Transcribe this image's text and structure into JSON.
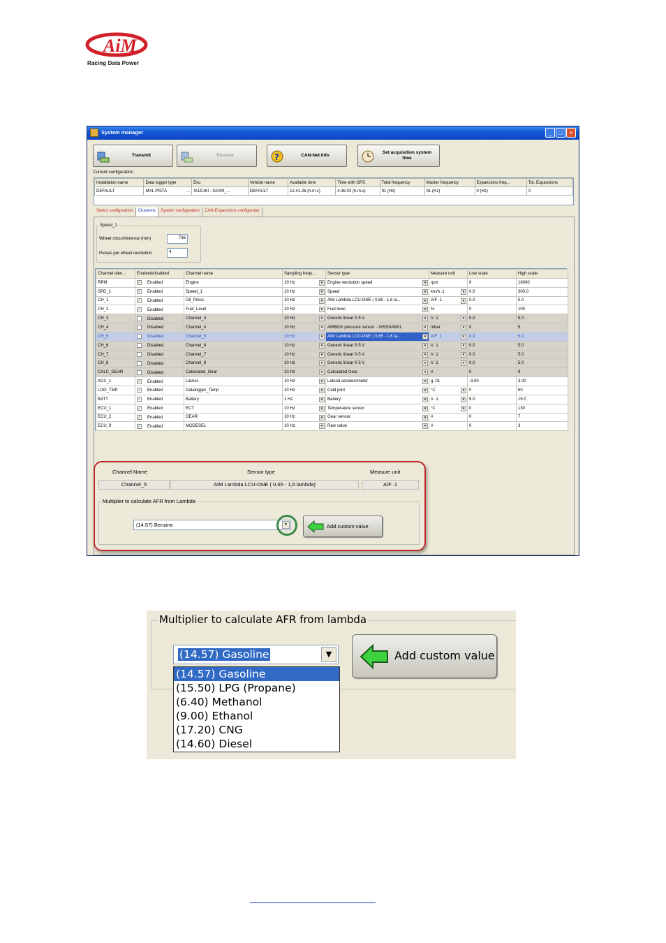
{
  "logo": {
    "brand": "AiM",
    "tagline": "Racing Data Power"
  },
  "window": {
    "title": "System manager",
    "toolbar": {
      "transmit": "Transmit",
      "receive": "Receive",
      "can_net_info": "CAN-Net info",
      "set_acq_line1": "Set acquisition system",
      "set_acq_line2": "time"
    },
    "current_config_label": "Current configuration",
    "config_table": {
      "headers": [
        "Installation name",
        "Data logger type",
        "Ecu",
        "Vehicle name",
        "Available time",
        "Time with GPS",
        "Total frequency",
        "Master frequency",
        "Expansions freq...",
        "Tot. Expansions"
      ],
      "row": [
        "DEFAULT",
        "MXL PISTA",
        "SUZUKI - GSXR_...",
        "DEFAULT",
        "12.41.26 (h.m.s)",
        "4.36.03 (h.m.s)",
        "91 (Hz)",
        "91 (Hz)",
        "0 (Hz)",
        "0"
      ],
      "row_browse": "..."
    },
    "tabs": [
      "Select configuration",
      "Channels",
      "System configuration",
      "CAN-Expansions configurator"
    ],
    "speed_group": {
      "title": "Speed_1",
      "wheel_label": "Wheel circumference   (mm)",
      "wheel_value": "736",
      "pulses_label": "Pulses per wheel revolution",
      "pulses_value": "4"
    },
    "channels": {
      "headers": [
        "Channel iden...",
        "Enabled/disabled",
        "Channel name",
        "Sampling frequ...",
        "Sensor type",
        "Measure unit",
        "Low scale",
        "High scale"
      ],
      "check_mark": "✓",
      "rows": [
        {
          "id": "RPM",
          "checked": true,
          "status": "Enabled",
          "name": "Engine",
          "freq": "10 Hz",
          "sensor": "Engine revolution speed",
          "unit": "rpm",
          "low": "0",
          "high": "16000",
          "state": "normal"
        },
        {
          "id": "SPD_1",
          "checked": true,
          "status": "Enabled",
          "name": "Speed_1",
          "freq": "10 Hz",
          "sensor": "Speed",
          "unit": "km/h  .1",
          "low": "0.0",
          "high": "300.0",
          "state": "normal"
        },
        {
          "id": "CH_1",
          "checked": true,
          "status": "Enabled",
          "name": "Oil_Press",
          "freq": "10 Hz",
          "sensor": "AIM Lambda LCU-ONE ( 0,65 - 1,6 la...",
          "unit": "A/F  .1",
          "low": "0.0",
          "high": "5.0",
          "state": "normal"
        },
        {
          "id": "CH_2",
          "checked": true,
          "status": "Enabled",
          "name": "Fuel_Level",
          "freq": "10 Hz",
          "sensor": "Fuel level",
          "unit": "%",
          "low": "0",
          "high": "100",
          "state": "normal"
        },
        {
          "id": "CH_3",
          "checked": false,
          "status": "Disabled",
          "name": "Channel_3",
          "freq": "10 Hz",
          "sensor": "Generic linear 0-5 V",
          "unit": "V  .1",
          "low": "0.0",
          "high": "5.0",
          "state": "disabled"
        },
        {
          "id": "CH_4",
          "checked": false,
          "status": "Disabled",
          "name": "Channel_4",
          "freq": "10 Hz",
          "sensor": "AIRBOX pressure sensor - X05SNAB01",
          "unit": "mbar",
          "low": "0",
          "high": "5",
          "state": "disabled"
        },
        {
          "id": "CH_5",
          "checked": false,
          "status": "Disabled",
          "name": "Channel_5",
          "freq": "10 Hz",
          "sensor": "AIM Lambda LCU-ONE ( 0,65 - 1,6 la...",
          "unit": "A/F  .1",
          "low": "0.0",
          "high": "5.0",
          "state": "selected"
        },
        {
          "id": "CH_6",
          "checked": false,
          "status": "Disabled",
          "name": "Channel_6",
          "freq": "10 Hz",
          "sensor": "Generic linear 0-5 V",
          "unit": "V  .1",
          "low": "0.0",
          "high": "5.0",
          "state": "disabled"
        },
        {
          "id": "CH_7",
          "checked": false,
          "status": "Disabled",
          "name": "Channel_7",
          "freq": "10 Hz",
          "sensor": "Generic linear 0-5 V",
          "unit": "V  .1",
          "low": "0.0",
          "high": "5.0",
          "state": "disabled"
        },
        {
          "id": "CH_8",
          "checked": false,
          "status": "Disabled",
          "name": "Channel_8",
          "freq": "10 Hz",
          "sensor": "Generic linear 0-5 V",
          "unit": "V  .1",
          "low": "0.0",
          "high": "5.0",
          "state": "disabled"
        },
        {
          "id": "CALC_GEAR",
          "checked": false,
          "status": "Disabled",
          "name": "Calculated_Gear",
          "freq": "10 Hz",
          "sensor": "Calculated Gear",
          "unit": "#",
          "low": "0",
          "high": "9",
          "state": "disabled"
        },
        {
          "id": "ACC_1",
          "checked": true,
          "status": "Enabled",
          "name": "LatAcc",
          "freq": "10 Hz",
          "sensor": "Lateral accelerometer",
          "unit": "g  .01",
          "low": "-3.00",
          "high": "3.00",
          "state": "normal"
        },
        {
          "id": "LOG_TMP",
          "checked": true,
          "status": "Enabled",
          "name": "Datalogger_Temp",
          "freq": "10 Hz",
          "sensor": "Cold joint",
          "unit": "°C",
          "low": "0",
          "high": "50",
          "state": "normal"
        },
        {
          "id": "BATT",
          "checked": true,
          "status": "Enabled",
          "name": "Battery",
          "freq": "1 Hz",
          "sensor": "Battery",
          "unit": "V  .1",
          "low": "5.0",
          "high": "15.0",
          "state": "normal"
        },
        {
          "id": "ECU_1",
          "checked": true,
          "status": "Enabled",
          "name": "ECT",
          "freq": "10 Hz",
          "sensor": "Temperature sensor",
          "unit": "°C",
          "low": "0",
          "high": "130",
          "state": "normal"
        },
        {
          "id": "ECU_2",
          "checked": true,
          "status": "Enabled",
          "name": "GEAR",
          "freq": "10 Hz",
          "sensor": "Gear sensor",
          "unit": "#",
          "low": "0",
          "high": "7",
          "state": "normal"
        },
        {
          "id": "ECU_9",
          "checked": true,
          "status": "Enabled",
          "name": "MODESEL",
          "freq": "10 Hz",
          "sensor": "Raw value",
          "unit": "#",
          "low": "0",
          "high": "3",
          "state": "normal"
        }
      ]
    },
    "popup": {
      "headers": [
        "Channel Name",
        "Sensor type",
        "Measure unit"
      ],
      "values": [
        "Channel_5",
        "AIM Lambda LCU-ONE ( 0,65 - 1,6 lambda)",
        "A/F  .1"
      ],
      "group_title": "Multiplier to calculate AFR from Lambda",
      "combo_value": "(14.57) Benzine",
      "add_button": "Add custom value"
    }
  },
  "zoom": {
    "group_title": "Multiplier to calculate AFR from lambda",
    "combo_value": "(14.57) Gasoline",
    "options": [
      "(14.57) Gasoline",
      "(15.50) LPG (Propane)",
      "(6.40) Methanol",
      "(9.00) Ethanol",
      "(17.20) CNG",
      "(14.60) Diesel"
    ],
    "add_button": "Add custom value"
  },
  "colors": {
    "accent_red": "#c02a2a",
    "selection_blue": "#316ac5",
    "arrow_green": "#3fd23f",
    "highlight_circle": "#3a8a4a"
  }
}
